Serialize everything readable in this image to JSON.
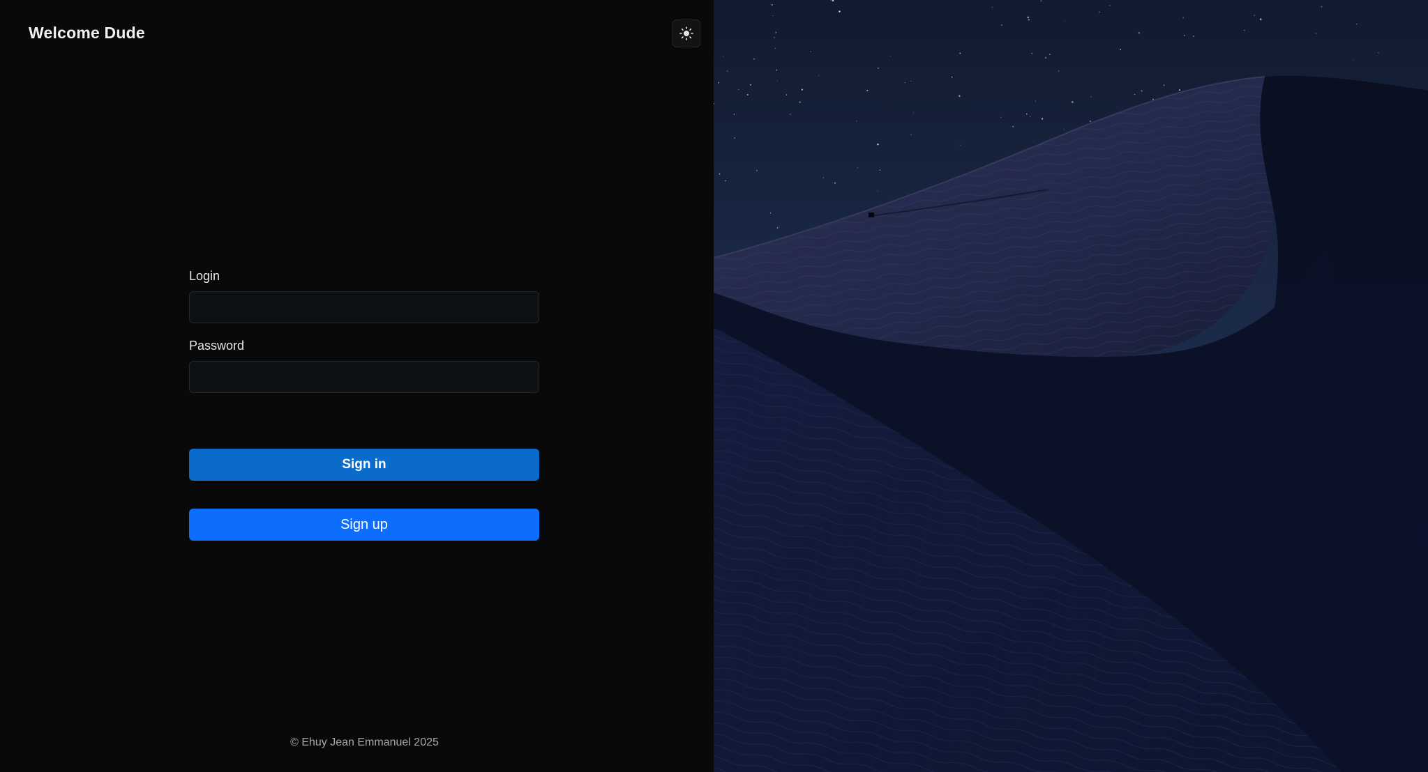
{
  "header": {
    "title": "Welcome Dude",
    "theme_toggle_icon": "sun-icon"
  },
  "form": {
    "login_label": "Login",
    "login_value": "",
    "password_label": "Password",
    "password_value": "",
    "signin_label": "Sign in",
    "signup_label": "Sign up"
  },
  "footer": {
    "copyright": "© Ehuy Jean Emmanuel 2025"
  },
  "hero": {
    "image": "night-desert-dunes-photo"
  },
  "colors": {
    "background": "#090909",
    "signin_button": "#0b6bcb",
    "signup_button": "#0d6efd",
    "sky": "#16223a",
    "dune": "#1c2340"
  }
}
